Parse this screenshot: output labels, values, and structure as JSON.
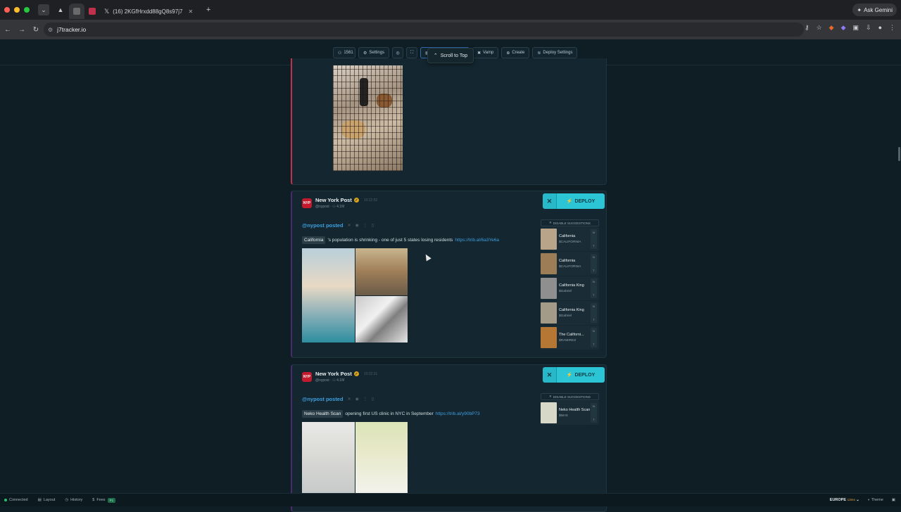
{
  "browser": {
    "tabs": [
      {
        "label": "",
        "active": false
      },
      {
        "label": "",
        "active": true
      },
      {
        "label": "",
        "active": false
      },
      {
        "label": "(16) 2KGfHrxdd88gQ8s97j7",
        "active": false
      }
    ],
    "new_tab": "+",
    "ask_gemini": "Ask Gemini",
    "url": "j7tracker.io"
  },
  "toolbar": {
    "users_count": "1561",
    "settings": "Settings",
    "vamp": "Vamp",
    "create": "Create",
    "deploy_settings": "Deploy Settings",
    "scroll_to_top": "Scroll to Top"
  },
  "posts": [
    {
      "author": "New York Post",
      "time": "10:22:52",
      "handle": "@nypost",
      "followers": "4.1M",
      "posted_label": "@nypost posted",
      "chip": "California",
      "text": "'s population is shrinking - one of just 5 states losing residents",
      "link": "https://trib.al/6a3Ye6a",
      "deploy": "DEPLOY",
      "disable_suggestions": "DISABLE SUGGESTIONS",
      "suggestions": [
        {
          "name": "California",
          "ticker": "$CALIFORNIA",
          "color": "#b9a48a"
        },
        {
          "name": "California",
          "ticker": "$CALIFORNIA",
          "color": "#9c7d55"
        },
        {
          "name": "California King",
          "ticker": "$Gabriel",
          "color": "#8f8f8f"
        },
        {
          "name": "California King",
          "ticker": "$Gabriel",
          "color": "#a49a88"
        },
        {
          "name": "The Californi...",
          "ticker": "$RAMIREZ",
          "color": "#b67734"
        }
      ]
    },
    {
      "author": "New York Post",
      "time": "10:22:31",
      "handle": "@nypost",
      "followers": "4.1M",
      "posted_label": "@nypost posted",
      "chip": "Neko Health Scan",
      "text": "opening first US clinic in NYC in September",
      "link": "https://trib.al/y90bP73",
      "deploy": "DEPLOY",
      "disable_suggestions": "DISABLE SUGGESTIONS",
      "suggestions": [
        {
          "name": "Neko Health Scan",
          "ticker": "$NHS",
          "color": "#d8d8c8"
        }
      ]
    }
  ],
  "statusbar": {
    "connected": "Connected",
    "layout": "Layout",
    "history": "History",
    "fees": "Fees",
    "fees_badge": "P1",
    "region": "EUROPE",
    "latency": "13ms",
    "theme": "Theme"
  },
  "colors": {
    "deploy": "#2cc5d6",
    "link": "#3d9fe0",
    "first_card_accent": "#c0314b"
  }
}
